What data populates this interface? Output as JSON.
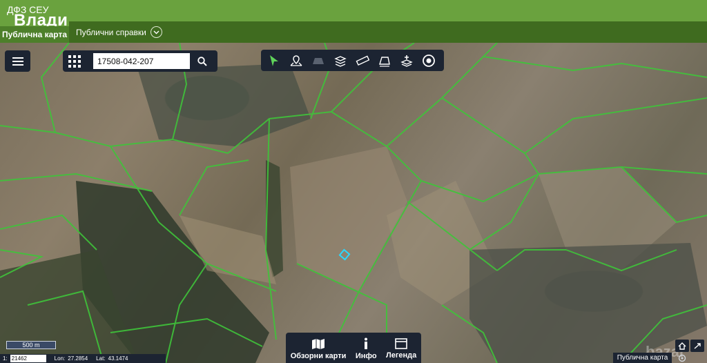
{
  "header": {
    "org": "ДФЗ СЕУ",
    "app_title": "Влади",
    "subtitle": "Публична карта",
    "nav_item": "Публични справки"
  },
  "search": {
    "value": "17508-042-207"
  },
  "toolbar": {
    "tools": [
      "select-icon",
      "location-pin-icon",
      "polygon-icon",
      "layers-stack-icon",
      "ruler-icon",
      "area-measure-icon",
      "add-layer-icon",
      "target-icon"
    ]
  },
  "bottom_panel": {
    "overview_label": "Обзорни карти",
    "info_label": "Инфо",
    "legend_label": "Легенда"
  },
  "scale": {
    "bar_label": "500 m",
    "ratio_prefix": "1:",
    "ratio_value": "21462",
    "lon_label": "Lon:",
    "lon_value": "27.2854",
    "lat_label": "Lat:",
    "lat_value": "43.1474"
  },
  "map_badge": "Публична карта",
  "watermark": "bazar",
  "colors": {
    "header_green": "#6aa23e",
    "nav_green": "#3f6b1f",
    "panel_dark": "#1c2432",
    "parcel_line": "#3fc43a",
    "selection": "#2ad8ff"
  }
}
